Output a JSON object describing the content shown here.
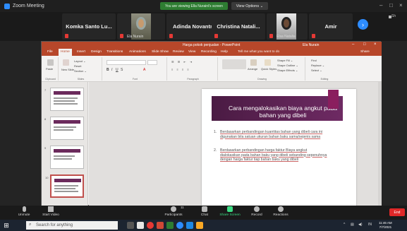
{
  "zoom": {
    "window_title": "Zoom Meeting",
    "share_banner": "You are viewing Ella Nuraini's screen",
    "view_options": "View Options ⌄",
    "side_label": "Sh"
  },
  "participants": [
    {
      "name": "Komka Santo Lu...",
      "muted": true
    },
    {
      "name": "",
      "video": true,
      "tag": "Ela Nurain"
    },
    {
      "name": "Adinda Novantri",
      "muted": true
    },
    {
      "name": "Christina Natali...",
      "muted": true
    },
    {
      "name": "",
      "video": true,
      "tag": "Elsa Natalia"
    },
    {
      "name": "Amir",
      "muted": true
    }
  ],
  "ppt": {
    "title": "Harga pokok penjualan - PowerPoint",
    "user": "Ela Nurain",
    "tabs": [
      "File",
      "Home",
      "Insert",
      "Design",
      "Transitions",
      "Animations",
      "Slide Show",
      "Review",
      "View",
      "Recording",
      "Help"
    ],
    "tell_me": "Tell me what you want to do",
    "share": "Share",
    "ribbon": {
      "paste": "Paste",
      "clipboard": "Clipboard",
      "new_slide": "New Slide",
      "layout": "Layout ⌄",
      "reset": "Reset",
      "section": "Section ⌄",
      "slides": "Slides",
      "font": "Font",
      "paragraph": "Paragraph",
      "arrange": "Arrange",
      "quick_styles": "Quick Styles",
      "shape_fill": "Shape Fill ⌄",
      "shape_outline": "Shape Outline ⌄",
      "shape_effects": "Shape Effects ⌄",
      "drawing": "Drawing",
      "find": "Find",
      "replace": "Replace ⌄",
      "select": "Select ⌄",
      "editing": "Editing"
    },
    "thumbnails": [
      "7",
      "8",
      "9",
      "10"
    ],
    "slide": {
      "title": "Cara mengalokasikan biaya angkut pada bahan yang dibeli",
      "bullets": [
        {
          "num": "1.",
          "text": "Berdasarkan perbandingan kuantitas bahan yang dibeli cara ini digunakan bila satuan ukuran bahan baku sama/sejenis sama"
        },
        {
          "num": "2.",
          "text": "Berdasarkan perbandingan harga faktur Biaya angkut dialokasikan pada bahan baku yang dibeli sebanding sepenuhnya dengan harga faktur tiap bahan baku yang dibeli"
        }
      ]
    }
  },
  "toolbar": {
    "unmute": "Unmute",
    "start_video": "Start Video",
    "participants": "Participants",
    "participants_count": "11",
    "chat": "Chat",
    "share_screen": "Share Screen",
    "record": "Record",
    "reactions": "Reactions",
    "end": "End"
  },
  "taskbar": {
    "search_placeholder": "Search for anything",
    "time": "11:46 AM",
    "date": "7/7/2021",
    "lang": "IN"
  },
  "colors": {
    "ppt_red": "#b7472a",
    "slide_banner": "#6e2a63",
    "zoom_blue": "#2d8cff",
    "share_green": "#2e7d32",
    "end_red": "#e02828"
  }
}
